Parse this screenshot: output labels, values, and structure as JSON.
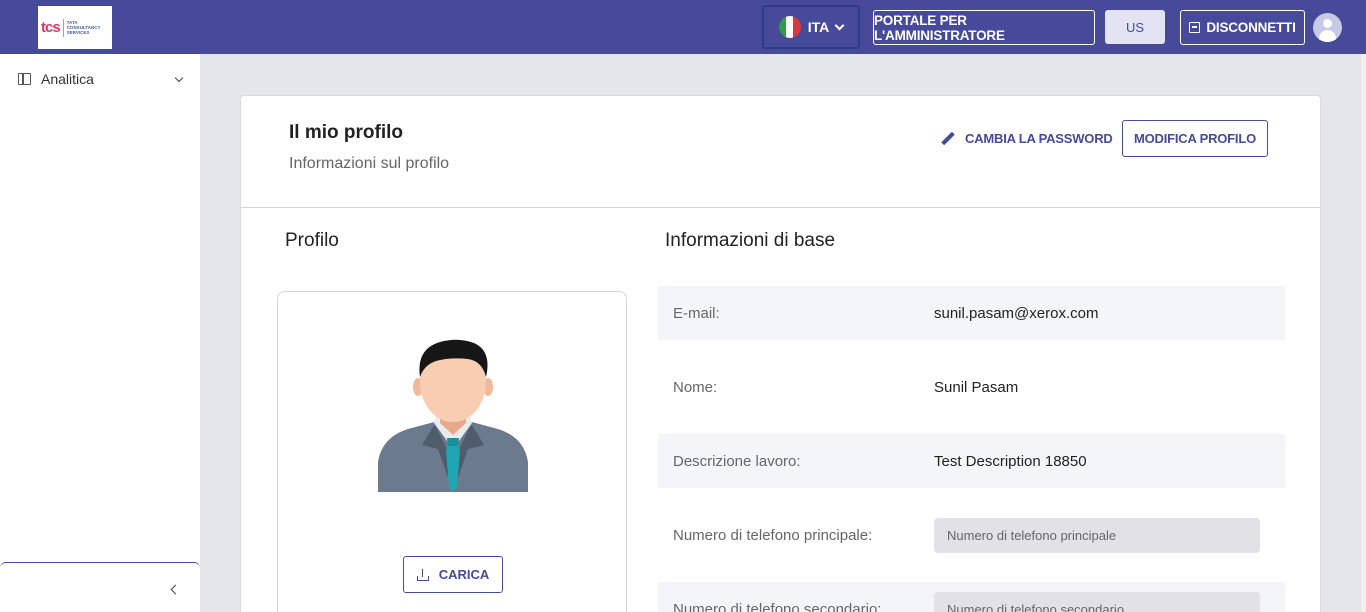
{
  "header": {
    "logo_text": "tcs",
    "logo_subtext": [
      "TATA",
      "CONSULTANCY",
      "SERVICES"
    ],
    "language": "ITA",
    "admin_portal": "PORTALE PER L'AMMINISTRATORE",
    "region": "US",
    "logout": "DISCONNETTI",
    "colors": {
      "bar": "#464a99",
      "accent": "#464a99"
    }
  },
  "sidebar": {
    "items": [
      {
        "label": "Analitica",
        "icon": "panel-icon"
      }
    ]
  },
  "profile": {
    "title": "Il mio profilo",
    "subtitle": "Informazioni sul profilo",
    "change_password": "CAMBIA LA PASSWORD",
    "edit_profile": "MODIFICA PROFILO",
    "section_profile": "Profilo",
    "section_basic": "Informazioni di base",
    "upload": "CARICA",
    "fields": [
      {
        "label": "E-mail:",
        "value": "sunil.pasam@xerox.com"
      },
      {
        "label": "Nome:",
        "value": "Sunil Pasam"
      },
      {
        "label": "Descrizione lavoro:",
        "value": "Test Description 18850"
      },
      {
        "label": "Numero di telefono principale:",
        "placeholder": "Numero di telefono principale"
      },
      {
        "label": "Numero di telefono secondario:",
        "placeholder": "Numero di telefono secondario"
      }
    ]
  }
}
